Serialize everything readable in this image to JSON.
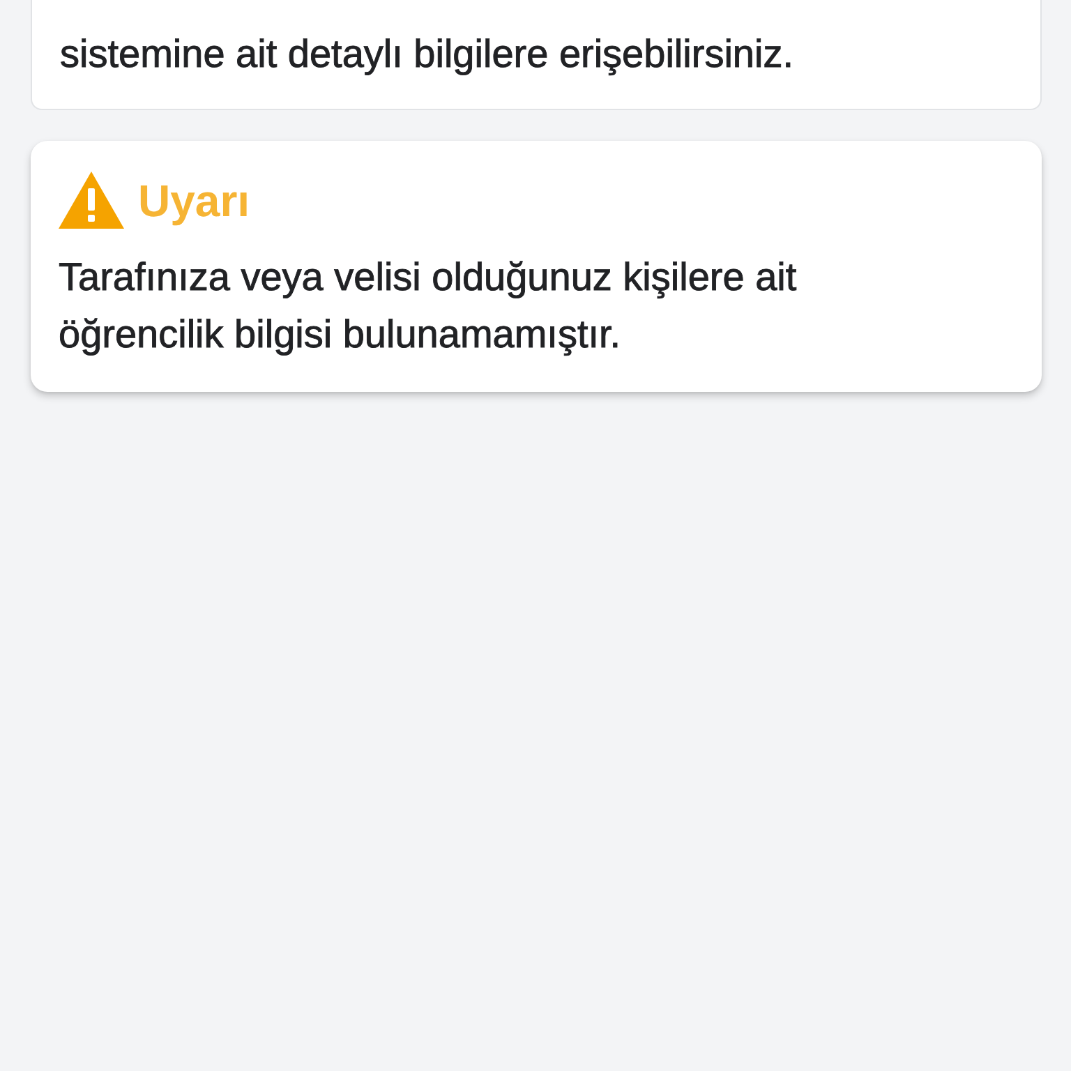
{
  "info_card": {
    "text": "sistemine ait detaylı bilgilere erişebilirsiniz."
  },
  "warning_card": {
    "kind": "warning",
    "title": "Uyarı",
    "message": "Tarafınıza veya velisi olduğunuz kişilere ait öğrencilik bilgisi bulunamamıştır."
  }
}
